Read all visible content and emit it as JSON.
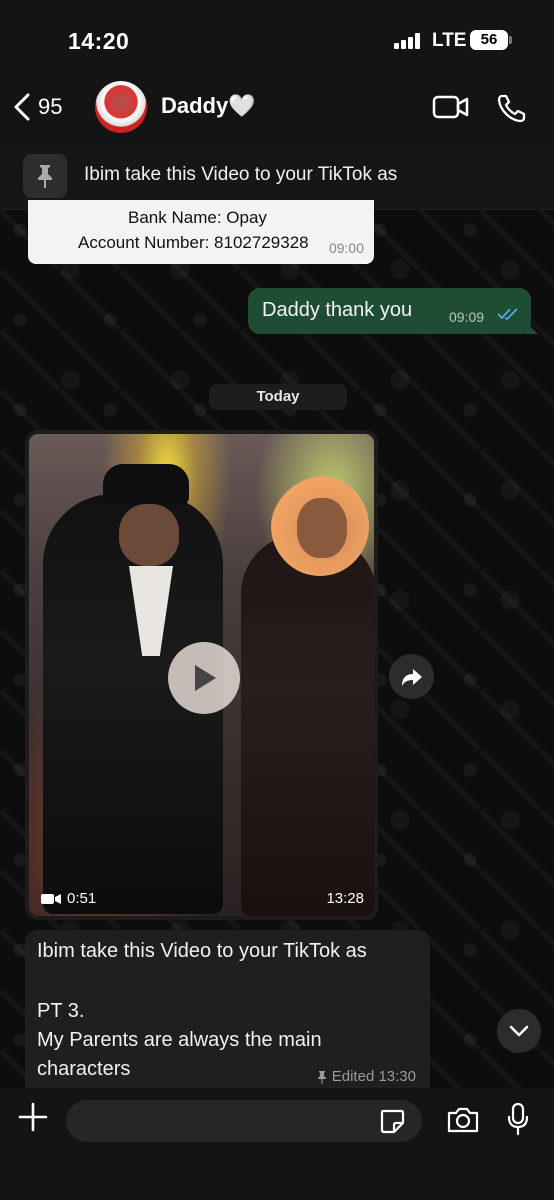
{
  "status_bar": {
    "time": "14:20",
    "network": "LTE",
    "battery": "56"
  },
  "header": {
    "back_count": "95",
    "contact_name": "Daddy🤍"
  },
  "pinned": {
    "text": "Ibim take this Video to your TikTok as"
  },
  "messages": {
    "bank_line1": "Bank Name: Opay",
    "bank_line2": "Account Number: 8102729328",
    "bank_time": "09:00",
    "outgoing_text": "Daddy thank you",
    "outgoing_time": "09:09",
    "date_chip": "Today",
    "video_duration": "0:51",
    "video_time": "13:28",
    "caption_line1": "Ibim take this Video to your TikTok as",
    "caption_line2": "PT 3.",
    "caption_line3": "My Parents are always the main",
    "caption_line4": "characters",
    "caption_meta": "Edited 13:30"
  },
  "input": {
    "placeholder": ""
  },
  "colors": {
    "outgoing_bubble": "#1f4d33",
    "read_ticks": "#5aa8f0",
    "background": "#0b0b0b"
  }
}
